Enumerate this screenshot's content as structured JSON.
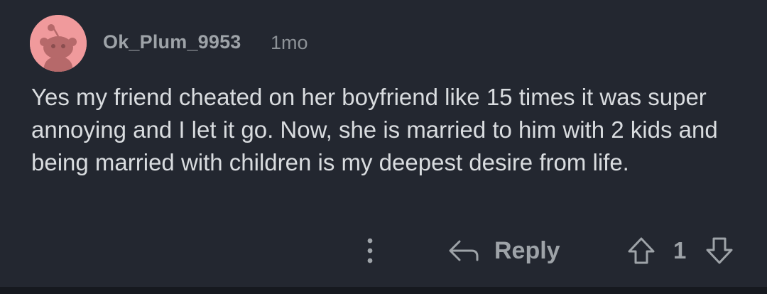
{
  "comment": {
    "author": "Ok_Plum_9953",
    "age": "1mo",
    "body": "Yes my friend cheated on her boyfriend like 15 times it was super annoying and I let it go. Now, she is married to him with 2 kids and being married with children is my deepest desire from life.",
    "avatar_icon": "snoo-avatar-icon",
    "avatar_color": "#f09a9c"
  },
  "actions": {
    "more_icon": "more-vertical-icon",
    "reply_icon": "reply-arrow-icon",
    "reply_label": "Reply",
    "upvote_icon": "upvote-arrow-icon",
    "vote_count": "1",
    "downvote_icon": "downvote-arrow-icon"
  },
  "colors": {
    "background": "#232730",
    "text": "#d9dcdf",
    "muted": "#9ea3a8"
  }
}
